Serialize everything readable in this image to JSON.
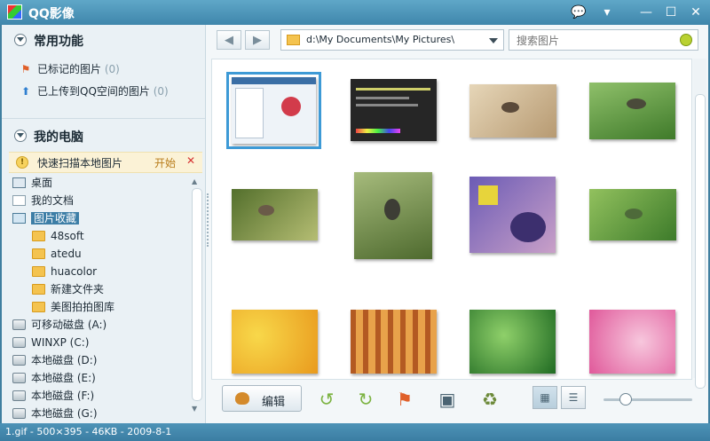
{
  "window": {
    "title": "QQ影像",
    "controls": [
      "💬",
      "▾",
      "—",
      "☐",
      "✕"
    ]
  },
  "sidebar": {
    "section1_title": "常用功能",
    "links": [
      {
        "label": "已标记的图片",
        "count": "(0)"
      },
      {
        "label": "已上传到QQ空间的图片",
        "count": "(0)"
      }
    ],
    "section2_title": "我的电脑",
    "scan": {
      "text": "快速扫描本地图片",
      "start": "开始",
      "close": "✕"
    },
    "tree": [
      {
        "label": "桌面",
        "icon": "desktop-icon"
      },
      {
        "label": "我的文档",
        "icon": "document-icon"
      },
      {
        "label": "图片收藏",
        "icon": "favorites-icon",
        "selected": true
      },
      {
        "label": "48soft",
        "icon": "folder-icon"
      },
      {
        "label": "atedu",
        "icon": "folder-icon"
      },
      {
        "label": "huacolor",
        "icon": "folder-icon"
      },
      {
        "label": "新建文件夹",
        "icon": "folder-icon"
      },
      {
        "label": "美图拍拍图库",
        "icon": "folder-icon"
      },
      {
        "label": "可移动磁盘 (A:)",
        "icon": "drive-icon"
      },
      {
        "label": "WINXP (C:)",
        "icon": "drive-icon"
      },
      {
        "label": "本地磁盘 (D:)",
        "icon": "drive-icon"
      },
      {
        "label": "本地磁盘 (E:)",
        "icon": "drive-icon"
      },
      {
        "label": "本地磁盘 (F:)",
        "icon": "drive-icon"
      },
      {
        "label": "本地磁盘 (G:)",
        "icon": "drive-icon"
      }
    ]
  },
  "toolbar": {
    "back": "◀",
    "forward": "▶",
    "path": "d:\\My Documents\\My Pictures\\",
    "search_placeholder": "搜索图片"
  },
  "thumbnails": [
    {
      "name": "screenshot-window",
      "colors": [
        "#dfe9f2",
        "#ffffff"
      ]
    },
    {
      "name": "screenshot-dark",
      "colors": [
        "#2b2b2b",
        "#444444"
      ]
    },
    {
      "name": "bird-branch-1",
      "colors": [
        "#d8c6a8",
        "#a58c6a"
      ]
    },
    {
      "name": "bird-flying-green",
      "colors": [
        "#6fa14a",
        "#3f7a2a"
      ]
    },
    {
      "name": "bird-branch-2",
      "colors": [
        "#6d8a3b",
        "#a8b26a"
      ]
    },
    {
      "name": "bird-twig-green",
      "colors": [
        "#8eaa63",
        "#556f33"
      ]
    },
    {
      "name": "magazine-cover",
      "colors": [
        "#5c4fa0",
        "#c9a0c8"
      ]
    },
    {
      "name": "bird-green-leaves",
      "colors": [
        "#7cae48",
        "#3d7b2a"
      ]
    },
    {
      "name": "yellow-leaves",
      "colors": [
        "#f2c32a",
        "#e99a1d"
      ]
    },
    {
      "name": "forest-autumn",
      "colors": [
        "#c86a2a",
        "#e8a24a"
      ]
    },
    {
      "name": "green-leaf-drops",
      "colors": [
        "#2f8a2e",
        "#7fc35a"
      ]
    },
    {
      "name": "pink-umbrella",
      "colors": [
        "#e86aa6",
        "#f4b0cf"
      ]
    }
  ],
  "bottom": {
    "edit_label": "编辑",
    "zoom_level": 0.25
  },
  "status": {
    "text": "1.gif - 500×395 - 46KB - 2009-8-1"
  }
}
